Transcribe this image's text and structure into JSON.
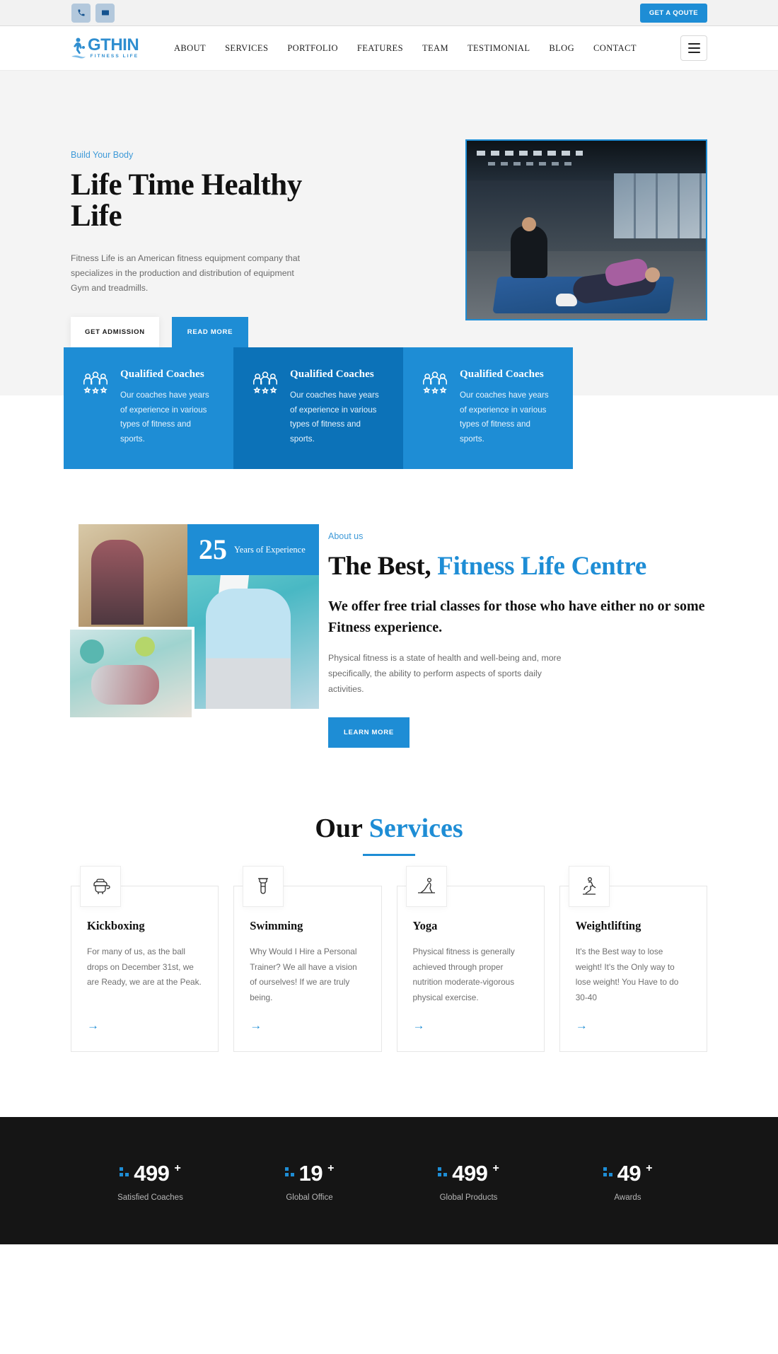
{
  "topbar": {
    "phone_icon": "phone-icon",
    "mail_icon": "envelope-icon",
    "quote_label": "GET A QOUTE"
  },
  "header": {
    "logo_name": "GTHIN",
    "logo_sub": "FITNESS LIFE",
    "nav": [
      {
        "label": "ABOUT"
      },
      {
        "label": "SERVICES"
      },
      {
        "label": "PORTFOLIO"
      },
      {
        "label": "FEATURES"
      },
      {
        "label": "TEAM"
      },
      {
        "label": "TESTIMONIAL"
      },
      {
        "label": "BLOG"
      },
      {
        "label": "CONTACT"
      }
    ],
    "menu_icon": "hamburger-menu-icon"
  },
  "hero": {
    "eyebrow": "Build Your Body",
    "heading": "Life Time Healthy Life",
    "paragraph": "Fitness Life is an American fitness equipment company that specializes in the production and distribution of equipment Gym and treadmills.",
    "btn_primary": "GET ADMISSION",
    "btn_secondary": "READ MORE",
    "image_alt": "trainer-assisting-woman-doing-situps-in-gym"
  },
  "features": [
    {
      "title": "Qualified Coaches",
      "text": "Our coaches have years of experience in various types of fitness and sports.",
      "icon": "coaches-group-icon",
      "variant": "norm"
    },
    {
      "title": "Qualified Coaches",
      "text": "Our coaches have years of experience in various types of fitness and sports.",
      "icon": "coaches-group-icon",
      "variant": "alt"
    },
    {
      "title": "Qualified Coaches",
      "text": "Our coaches have years of experience in various types of fitness and sports.",
      "icon": "coaches-group-icon",
      "variant": "norm"
    }
  ],
  "about": {
    "badge_number": "25",
    "badge_label": "Years of Experience",
    "eyebrow": "About us",
    "heading_plain": "The Best, ",
    "heading_accent": "Fitness Life Centre",
    "subheading": "We offer free trial classes for those who have either no or some Fitness experience.",
    "paragraph": "Physical fitness is a state of health and well-being and, more specifically, the ability to perform aspects of sports daily activities.",
    "btn_label": "LEARN MORE"
  },
  "services": {
    "title_plain": "Our ",
    "title_accent": "Services",
    "cards": [
      {
        "title": "Kickboxing",
        "text": "For many of us, as the ball drops on December 31st, we are Ready, we are at the Peak.",
        "icon": "kickboxing-icon",
        "arrow": "→"
      },
      {
        "title": "Swimming",
        "text": "Why Would I Hire a Personal Trainer? We all have a vision of ourselves! If we are truly being.",
        "icon": "swimming-icon",
        "arrow": "→"
      },
      {
        "title": "Yoga",
        "text": "Physical fitness is generally achieved through proper nutrition moderate-vigorous physical exercise.",
        "icon": "yoga-icon",
        "arrow": "→"
      },
      {
        "title": "Weightlifting",
        "text": "It's the Best way to lose weight! It's the Only way to lose weight! You Have to do 30-40",
        "icon": "weightlifting-icon",
        "arrow": "→"
      }
    ]
  },
  "stats": [
    {
      "number": "499",
      "plus": "+",
      "label": "Satisfied Coaches"
    },
    {
      "number": "19",
      "plus": "+",
      "label": "Global Office"
    },
    {
      "number": "499",
      "plus": "+",
      "label": "Global Products"
    },
    {
      "number": "49",
      "plus": "+",
      "label": "Awards"
    }
  ],
  "colors": {
    "accent": "#1e8dd5",
    "accent_dark": "#0c72b8",
    "hero_bg": "#f4f4f4",
    "stats_bg": "#151515",
    "topbar_bg": "#f2f2f2"
  }
}
